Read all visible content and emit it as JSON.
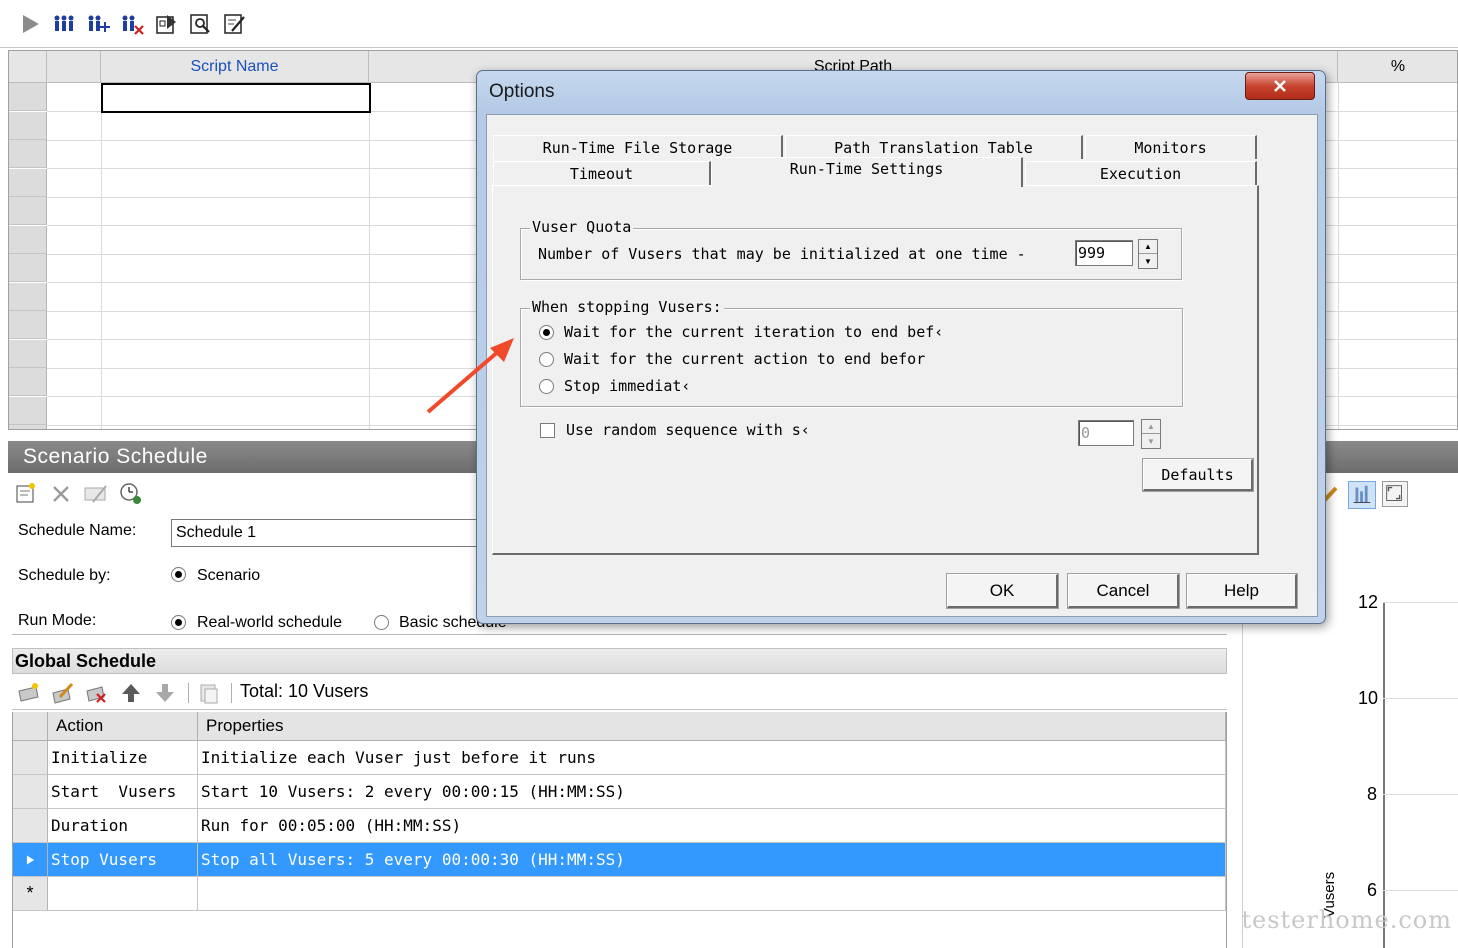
{
  "toolbar": {
    "icons": [
      "play-icon",
      "vusers-icon",
      "add-vusers-icon",
      "remove-vusers-icon",
      "details-icon",
      "search-script-icon",
      "edit-script-icon"
    ]
  },
  "scripts_grid": {
    "columns": [
      "Script Name",
      "Script Path",
      "%"
    ]
  },
  "scenario_schedule": {
    "title": "Scenario Schedule",
    "schedule_name_label": "Schedule Name:",
    "schedule_name_value": "Schedule 1",
    "schedule_by_label": "Schedule by:",
    "schedule_by_option": "Scenario",
    "run_mode_label": "Run Mode:",
    "run_mode_real": "Real-world schedule",
    "run_mode_basic": "Basic schedule"
  },
  "global_schedule": {
    "title": "Global Schedule",
    "total": "Total: 10 Vusers",
    "columns": [
      "Action",
      "Properties"
    ],
    "rows": [
      {
        "action": "Initialize",
        "properties": "Initialize each Vuser just before it runs"
      },
      {
        "action": "Start  Vusers",
        "properties": "Start 10 Vusers: 2 every 00:00:15 (HH:MM:SS)"
      },
      {
        "action": "Duration",
        "properties": "Run for 00:05:00 (HH:MM:SS)"
      },
      {
        "action": "Stop Vusers",
        "properties": "Stop all Vusers: 5 every 00:00:30 (HH:MM:SS)"
      }
    ],
    "new_row_marker": "*"
  },
  "chart": {
    "ylabel": "Vusers",
    "yticks": [
      "12",
      "10",
      "8",
      "6"
    ]
  },
  "dialog": {
    "title": "Options",
    "close": "✕",
    "tabs_row1": [
      "Run-Time File Storage",
      "Path Translation Table",
      "Monitors"
    ],
    "tabs_row2": [
      "Timeout",
      "Run-Time Settings",
      "Execution"
    ],
    "active_tab": "Run-Time Settings",
    "vuser_quota_label": "Vuser Quota",
    "vuser_quota_text": "Number of Vusers that may be initialized at one time -",
    "vuser_quota_value": "999",
    "stopping_label": "When stopping Vusers:",
    "stopping_options": [
      "Wait for the current iteration to end bef‹",
      "Wait for the current action to end befor",
      "Stop immediat‹"
    ],
    "random_seq_label": "Use random sequence with s‹",
    "random_seq_value": "0",
    "defaults_button": "Defaults",
    "ok_button": "OK",
    "cancel_button": "Cancel",
    "help_button": "Help"
  },
  "watermark": "testerhome.com",
  "colors": {
    "selection": "#3399ff",
    "dialog_frame": "#bfd2ea",
    "close_button": "#c8432f",
    "annotation_arrow": "#f04a2a",
    "header_text_blue": "#1b4fbf"
  }
}
